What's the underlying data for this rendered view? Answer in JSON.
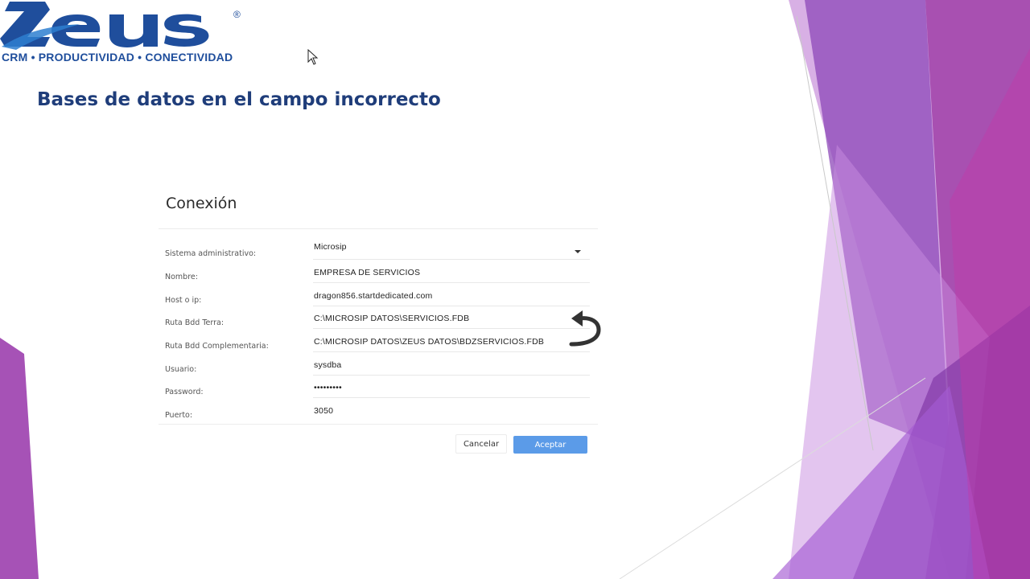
{
  "logo": {
    "brand": "ZEUS",
    "registered": "®",
    "tagline": "CRM • PRODUCTIVIDAD • CONECTIVIDAD"
  },
  "slide": {
    "title": "Bases de datos en el campo incorrecto"
  },
  "dialog": {
    "title": "Conexión",
    "fields": [
      {
        "label": "Sistema administrativo:",
        "value": "Microsip",
        "type": "select"
      },
      {
        "label": "Nombre:",
        "value": "EMPRESA DE SERVICIOS"
      },
      {
        "label": "Host o ip:",
        "value": "dragon856.startdedicated.com"
      },
      {
        "label": "Ruta Bdd Terra:",
        "value": "C:\\MICROSIP DATOS\\SERVICIOS.FDB"
      },
      {
        "label": "Ruta Bdd Complementaria:",
        "value": "C:\\MICROSIP DATOS\\ZEUS DATOS\\BDZSERVICIOS.FDB"
      },
      {
        "label": "Usuario:",
        "value": "sysdba"
      },
      {
        "label": "Password:",
        "value": "•••••••••"
      },
      {
        "label": "Puerto:",
        "value": "3050"
      }
    ],
    "cancel_label": "Cancelar",
    "accept_label": "Aceptar"
  },
  "colors": {
    "brand_blue": "#1f4e9c",
    "title_blue": "#1f3d7a",
    "accept_button": "#5b9be8",
    "purple_accent": "#9b3fb0"
  },
  "icons": {
    "swap_arrow": "curved-swap-arrow-icon",
    "cursor": "mouse-pointer-icon",
    "dropdown": "chevron-down-icon"
  }
}
